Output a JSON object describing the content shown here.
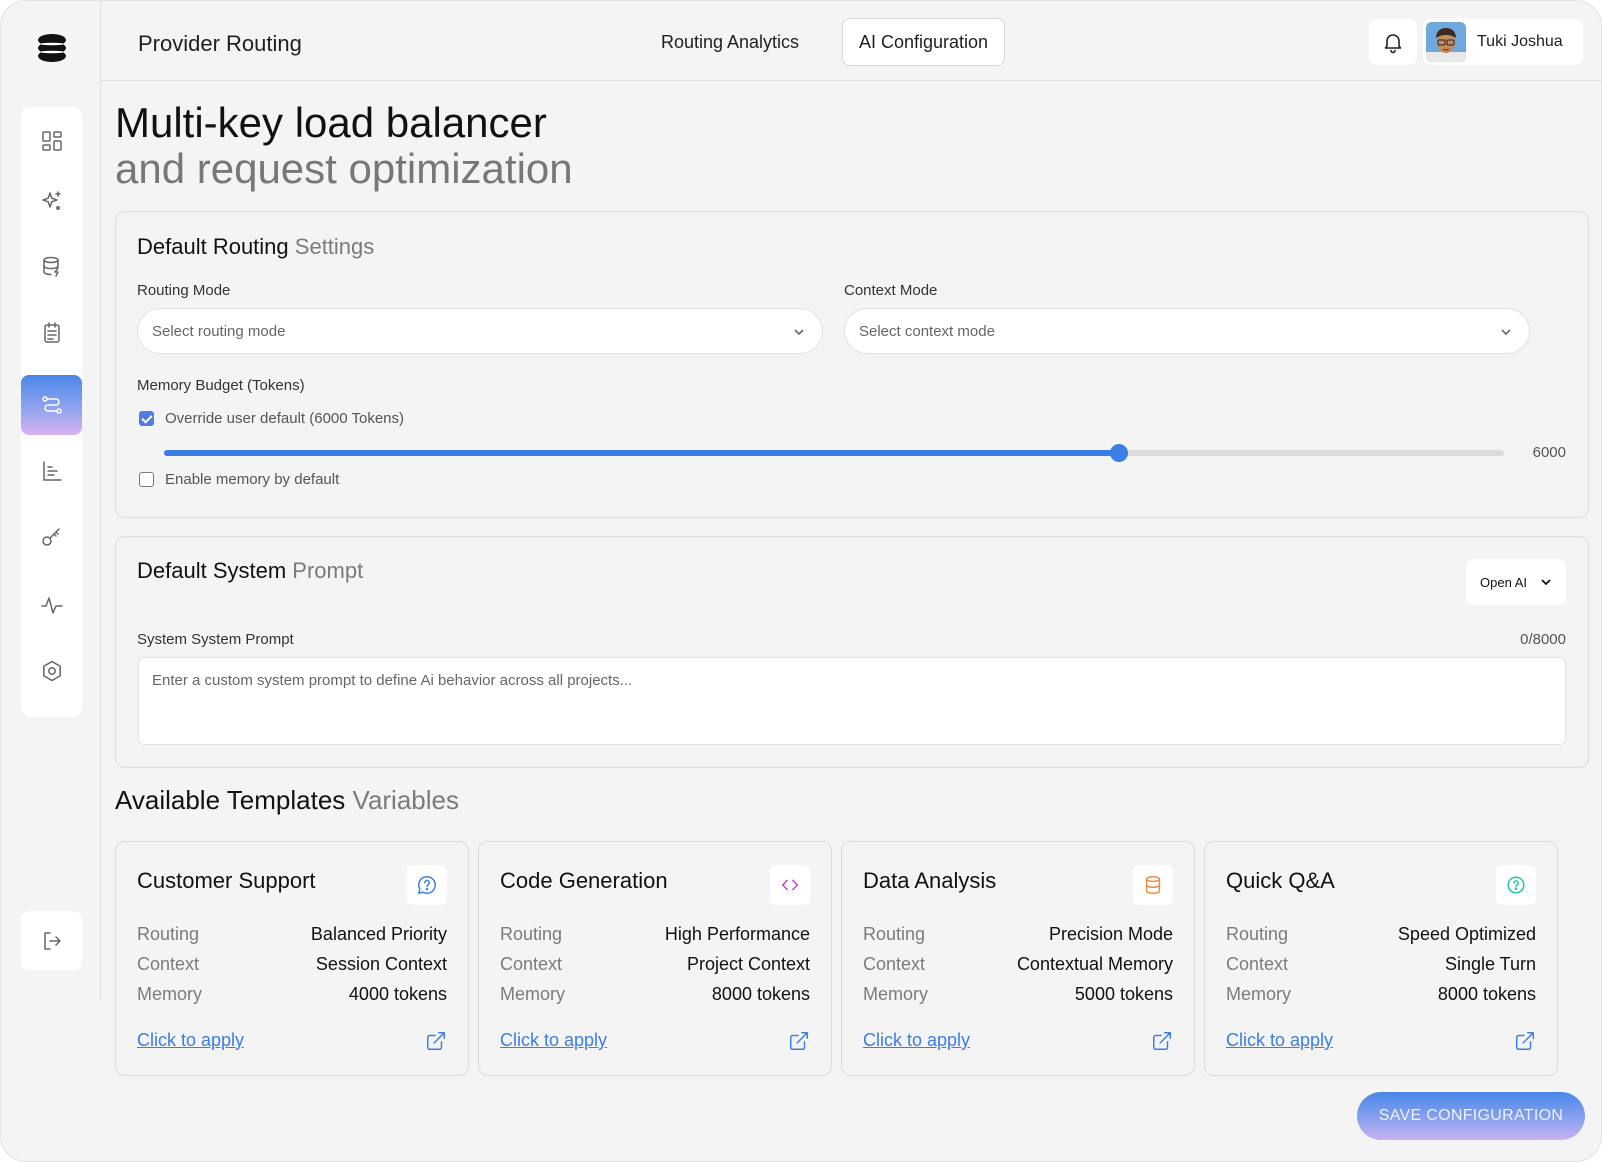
{
  "header": {
    "app_title": "Provider Routing",
    "tabs": [
      {
        "label": "Routing Analytics",
        "active": false
      },
      {
        "label": "AI Configuration",
        "active": true
      }
    ],
    "user": {
      "name": "Tuki Joshua"
    }
  },
  "sidebar": {
    "items": [
      {
        "icon": "dashboard-icon",
        "active": false
      },
      {
        "icon": "sparkles-icon",
        "active": false
      },
      {
        "icon": "database-icon",
        "active": false
      },
      {
        "icon": "clipboard-icon",
        "active": false
      },
      {
        "icon": "route-icon",
        "active": true
      },
      {
        "icon": "bar-chart-icon",
        "active": false
      },
      {
        "icon": "key-icon",
        "active": false
      },
      {
        "icon": "activity-icon",
        "active": false
      },
      {
        "icon": "settings-icon",
        "active": false
      }
    ],
    "logout_icon": "logout-icon"
  },
  "hero": {
    "title": "Multi-key load balancer",
    "subtitle": "and request optimization"
  },
  "routing_settings": {
    "title_main": "Default Routing",
    "title_muted": "Settings",
    "routing_mode": {
      "label": "Routing Mode",
      "placeholder": "Select routing mode"
    },
    "context_mode": {
      "label": "Context Mode",
      "placeholder": "Select context mode"
    },
    "memory": {
      "label": "Memory Budget (Tokens)",
      "override_label": "Override user default (6000 Tokens)",
      "override_checked": true,
      "value": 6000,
      "value_label": "6000",
      "slider_fraction": 0.713,
      "enable_label": "Enable memory by default",
      "enable_checked": false
    }
  },
  "system_prompt": {
    "title_main": "Default System",
    "title_muted": "Prompt",
    "model": "Open AI",
    "field_label": "System System Prompt",
    "counter": "0/8000",
    "placeholder": "Enter a custom system prompt to define Ai behavior across all projects..."
  },
  "templates": {
    "title_main": "Available Templates",
    "title_muted": "Variables",
    "items": [
      {
        "title": "Customer Support",
        "icon": "help-circle-icon",
        "icon_color": "#3b7ee6",
        "routing_label": "Routing",
        "routing": "Balanced Priority",
        "context_label": "Context",
        "context": "Session Context",
        "memory_label": "Memory",
        "memory": "4000 tokens",
        "apply": "Click to apply"
      },
      {
        "title": "Code Generation",
        "icon": "code-icon",
        "icon_color": "#d13bd1",
        "routing_label": "Routing",
        "routing": "High Performance",
        "context_label": "Context",
        "context": "Project Context",
        "memory_label": "Memory",
        "memory": "8000 tokens",
        "apply": "Click to apply"
      },
      {
        "title": "Data Analysis",
        "icon": "database-icon",
        "icon_color": "#f08a3c",
        "routing_label": "Routing",
        "routing": "Precision Mode",
        "context_label": "Context",
        "context": "Contextual Memory",
        "memory_label": "Memory",
        "memory": "5000 tokens",
        "apply": "Click to apply"
      },
      {
        "title": "Quick Q&A",
        "icon": "question-circle-icon",
        "icon_color": "#22c8a6",
        "routing_label": "Routing",
        "routing": "Speed Optimized",
        "context_label": "Context",
        "context": "Single Turn",
        "memory_label": "Memory",
        "memory": "8000 tokens",
        "apply": "Click to apply"
      }
    ]
  },
  "save_label": "SAVE CONFIGURATION"
}
